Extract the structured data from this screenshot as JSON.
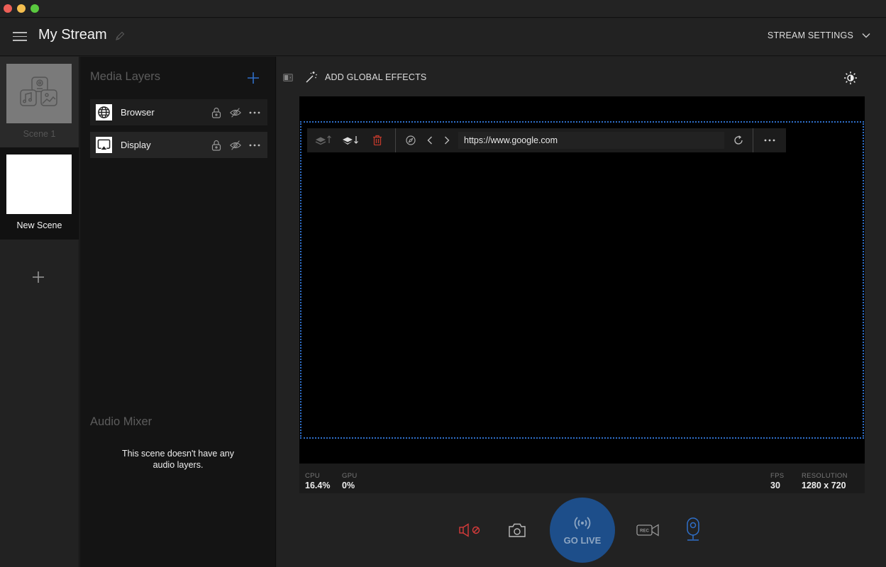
{
  "window": {
    "traffic_lights": [
      "close",
      "minimize",
      "maximize"
    ]
  },
  "header": {
    "menu_icon": "hamburger-icon",
    "title": "My Stream",
    "edit_icon": "pencil-icon",
    "stream_settings_label": "STREAM SETTINGS",
    "stream_settings_icon": "chevron-down-icon"
  },
  "scenes": {
    "items": [
      {
        "label": "Scene 1",
        "thumbnail": "media-placeholder",
        "state": "inactive"
      },
      {
        "label": "New Scene",
        "thumbnail": "blank-white",
        "state": "selected"
      }
    ],
    "add_icon": "plus-icon"
  },
  "media_layers": {
    "title": "Media Layers",
    "add_icon": "plus-icon",
    "items": [
      {
        "name": "Browser",
        "icon": "globe-icon",
        "locked": false,
        "hidden": true
      },
      {
        "name": "Display",
        "icon": "airplay-display-icon",
        "locked": false,
        "hidden": true
      }
    ]
  },
  "audio_mixer": {
    "title": "Audio Mixer",
    "empty_message_line1": "This scene doesn't have any",
    "empty_message_line2": "audio layers."
  },
  "main": {
    "effects_label": "ADD GLOBAL EFFECTS",
    "theme_icon": "brightness-icon",
    "layer_toolbar": {
      "url": "https://www.google.com",
      "buttons": [
        "move-layer-up",
        "move-layer-down",
        "delete-layer",
        "compass",
        "back",
        "forward",
        "reload",
        "more"
      ]
    },
    "stats": {
      "cpu_label": "CPU",
      "cpu_value": "16.4%",
      "gpu_label": "GPU",
      "gpu_value": "0%",
      "fps_label": "FPS",
      "fps_value": "30",
      "resolution_label": "RESOLUTION",
      "resolution_value": "1280 x 720"
    }
  },
  "controls": {
    "go_live_label": "GO LIVE",
    "rec_label": "REC",
    "colors": {
      "muted": "#d63b3b",
      "go_live_bg": "#1d4e8a",
      "webcam_active": "#2f6fc9"
    }
  }
}
